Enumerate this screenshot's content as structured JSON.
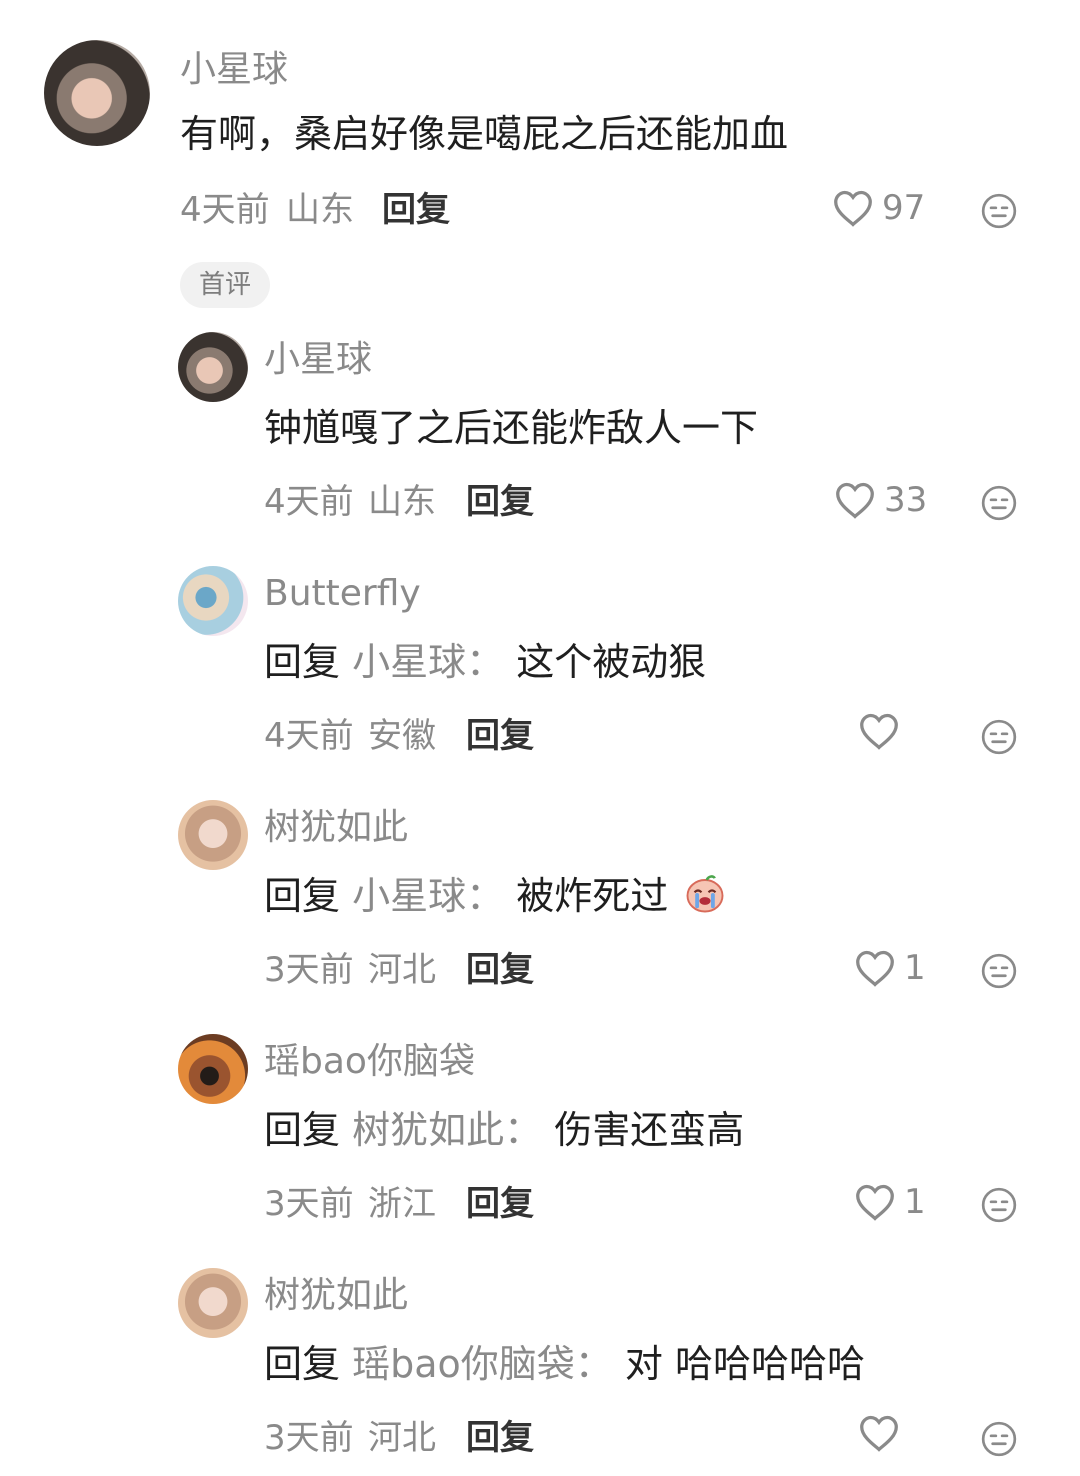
{
  "comments": [
    {
      "username": "小星球",
      "text": "有啊，桑启好像是噶屁之后还能加血",
      "time": "4天前",
      "location": "山东",
      "reply_label": "回复",
      "likes": "97",
      "badge": "首评"
    },
    {
      "username": "小星球",
      "text": "钟馗嘎了之后还能炸敌人一下",
      "time": "4天前",
      "location": "山东",
      "reply_label": "回复",
      "likes": "33"
    },
    {
      "username": "Butterfly",
      "reply_prefix": "回复",
      "reply_target": "小星球：",
      "text": "这个被动狠",
      "time": "4天前",
      "location": "安徽",
      "reply_label": "回复",
      "likes": ""
    },
    {
      "username": "树犹如此",
      "reply_prefix": "回复",
      "reply_target": "小星球：",
      "text": "被炸死过",
      "time": "3天前",
      "location": "河北",
      "reply_label": "回复",
      "likes": "1"
    },
    {
      "username": "瑶bao你脑袋",
      "reply_prefix": "回复",
      "reply_target": "树犹如此：",
      "text": "伤害还蛮高",
      "time": "3天前",
      "location": "浙江",
      "reply_label": "回复",
      "likes": "1"
    },
    {
      "username": "树犹如此",
      "reply_prefix": "回复",
      "reply_target": "瑶bao你脑袋：",
      "text": "对 哈哈哈哈哈",
      "time": "3天前",
      "location": "河北",
      "reply_label": "回复",
      "likes": ""
    }
  ],
  "icons": {
    "like": "heart-outline-icon",
    "dislike": "neutral-face-icon",
    "emoji": "crying-emoji-icon"
  },
  "colors": {
    "username": "#8a8a8a",
    "text": "#1f1f1f",
    "badge_bg": "#f1f1f1"
  }
}
